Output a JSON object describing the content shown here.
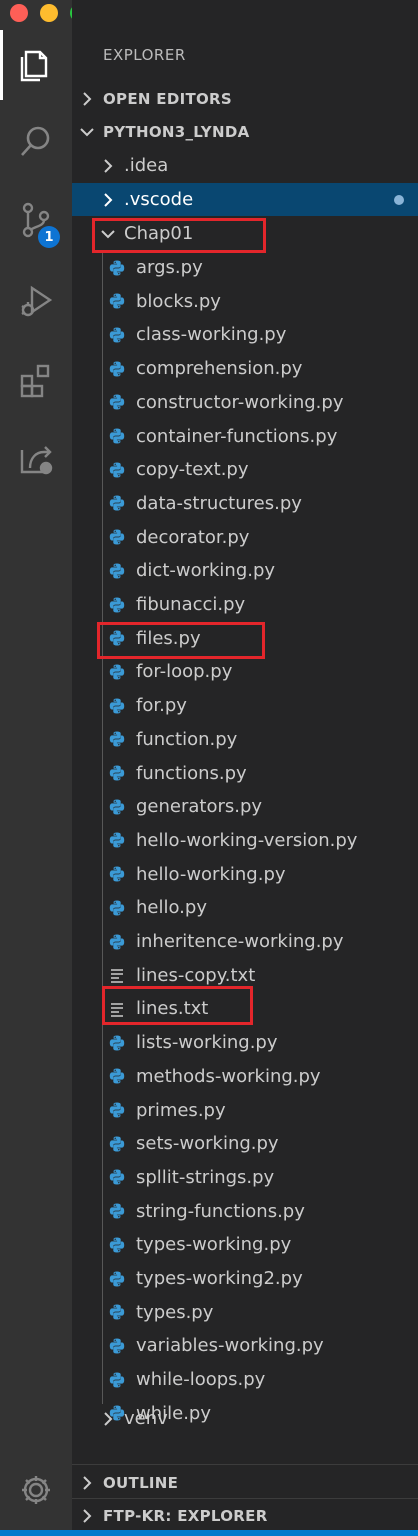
{
  "explorer": {
    "title": "EXPLORER",
    "open_editors": "OPEN EDITORS",
    "project": "PYTHON3_LYNDA",
    "folders": {
      "idea": ".idea",
      "vscode": ".vscode",
      "chap": "Chap01",
      "venv": "venv"
    },
    "files": [
      {
        "name": "args.py",
        "type": "python"
      },
      {
        "name": "blocks.py",
        "type": "python"
      },
      {
        "name": "class-working.py",
        "type": "python"
      },
      {
        "name": "comprehension.py",
        "type": "python"
      },
      {
        "name": "constructor-working.py",
        "type": "python"
      },
      {
        "name": "container-functions.py",
        "type": "python"
      },
      {
        "name": "copy-text.py",
        "type": "python"
      },
      {
        "name": "data-structures.py",
        "type": "python"
      },
      {
        "name": "decorator.py",
        "type": "python"
      },
      {
        "name": "dict-working.py",
        "type": "python"
      },
      {
        "name": "fibunacci.py",
        "type": "python"
      },
      {
        "name": "files.py",
        "type": "python"
      },
      {
        "name": "for-loop.py",
        "type": "python"
      },
      {
        "name": "for.py",
        "type": "python"
      },
      {
        "name": "function.py",
        "type": "python"
      },
      {
        "name": "functions.py",
        "type": "python"
      },
      {
        "name": "generators.py",
        "type": "python"
      },
      {
        "name": "hello-working-version.py",
        "type": "python"
      },
      {
        "name": "hello-working.py",
        "type": "python"
      },
      {
        "name": "hello.py",
        "type": "python"
      },
      {
        "name": "inheritence-working.py",
        "type": "python"
      },
      {
        "name": "lines-copy.txt",
        "type": "text"
      },
      {
        "name": "lines.txt",
        "type": "text"
      },
      {
        "name": "lists-working.py",
        "type": "python"
      },
      {
        "name": "methods-working.py",
        "type": "python"
      },
      {
        "name": "primes.py",
        "type": "python"
      },
      {
        "name": "sets-working.py",
        "type": "python"
      },
      {
        "name": "spllit-strings.py",
        "type": "python"
      },
      {
        "name": "string-functions.py",
        "type": "python"
      },
      {
        "name": "types-working.py",
        "type": "python"
      },
      {
        "name": "types-working2.py",
        "type": "python"
      },
      {
        "name": "types.py",
        "type": "python"
      },
      {
        "name": "variables-working.py",
        "type": "python"
      },
      {
        "name": "while-loops.py",
        "type": "python"
      },
      {
        "name": "while.py",
        "type": "python"
      }
    ],
    "outline": "OUTLINE",
    "ftp": "FTP-KR: EXPLORER"
  },
  "activity": {
    "icons": [
      "files-icon",
      "search-icon",
      "source-control-icon",
      "run-debug-icon",
      "extensions-icon",
      "remote-explorer-icon",
      "settings-gear-icon"
    ],
    "source_control_badge": "1"
  },
  "colors": {
    "accent": "#007acc",
    "selection": "#094771",
    "highlight_box": "#e3262b",
    "python_icon": "#3b9ad6"
  }
}
